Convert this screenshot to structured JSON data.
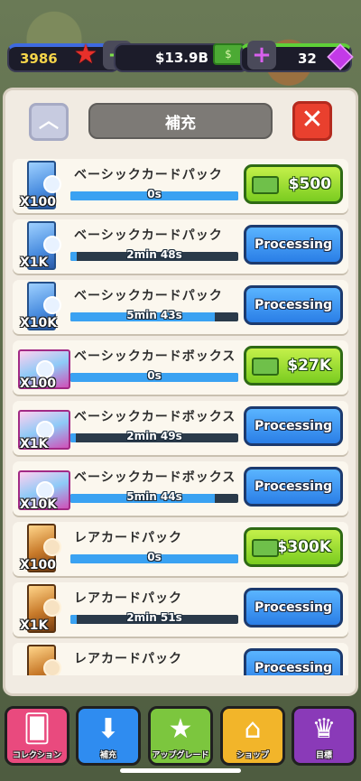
{
  "hud": {
    "stars": "3986",
    "money": "$13.9B",
    "gems": "32",
    "star_icon": "star-icon",
    "cash_icon": "cash-icon",
    "gem_icon": "gem-icon",
    "plus_symbol": "+"
  },
  "panel": {
    "title": "補充",
    "up_symbol": "︿",
    "close_symbol": "✕"
  },
  "items": [
    {
      "name": "ベーシックカードパック",
      "qty": "X100",
      "timer": "0s",
      "progress": 1.0,
      "button": "$500",
      "state": "buy",
      "kind": "pack"
    },
    {
      "name": "ベーシックカードパック",
      "qty": "X1K",
      "timer": "2min 48s",
      "progress": 0.04,
      "button": "Processing",
      "state": "processing",
      "kind": "pack"
    },
    {
      "name": "ベーシックカードパック",
      "qty": "X10K",
      "timer": "5min 43s",
      "progress": 0.86,
      "button": "Processing",
      "state": "processing",
      "kind": "pack"
    },
    {
      "name": "ベーシックカードボックス",
      "qty": "X100",
      "timer": "0s",
      "progress": 1.0,
      "button": "$27K",
      "state": "buy",
      "kind": "box"
    },
    {
      "name": "ベーシックカードボックス",
      "qty": "X1K",
      "timer": "2min 49s",
      "progress": 0.03,
      "button": "Processing",
      "state": "processing",
      "kind": "box"
    },
    {
      "name": "ベーシックカードボックス",
      "qty": "X10K",
      "timer": "5min 44s",
      "progress": 0.86,
      "button": "Processing",
      "state": "processing",
      "kind": "box"
    },
    {
      "name": "レアカードパック",
      "qty": "X100",
      "timer": "0s",
      "progress": 1.0,
      "button": "$300K",
      "state": "buy",
      "kind": "rare"
    },
    {
      "name": "レアカードパック",
      "qty": "X1K",
      "timer": "2min 51s",
      "progress": 0.04,
      "button": "Processing",
      "state": "processing",
      "kind": "rare"
    },
    {
      "name": "レアカードパック",
      "qty": "",
      "timer": "",
      "progress": 0.0,
      "button": "Processing",
      "state": "processing",
      "kind": "rare"
    }
  ],
  "nav": [
    {
      "label": "コレクション",
      "icon": "cards-icon",
      "glyph": "🂠"
    },
    {
      "label": "補充",
      "icon": "restock-icon",
      "glyph": "⬇"
    },
    {
      "label": "アップグレード",
      "icon": "upgrade-star-icon",
      "glyph": "★"
    },
    {
      "label": "ショップ",
      "icon": "shop-icon",
      "glyph": "⌂"
    },
    {
      "label": "目標",
      "icon": "trophy-icon",
      "glyph": "♛"
    }
  ],
  "colors": {
    "processing": "#2a7ee6",
    "buy": "#7acc20",
    "progress": "#3aa2f2"
  }
}
